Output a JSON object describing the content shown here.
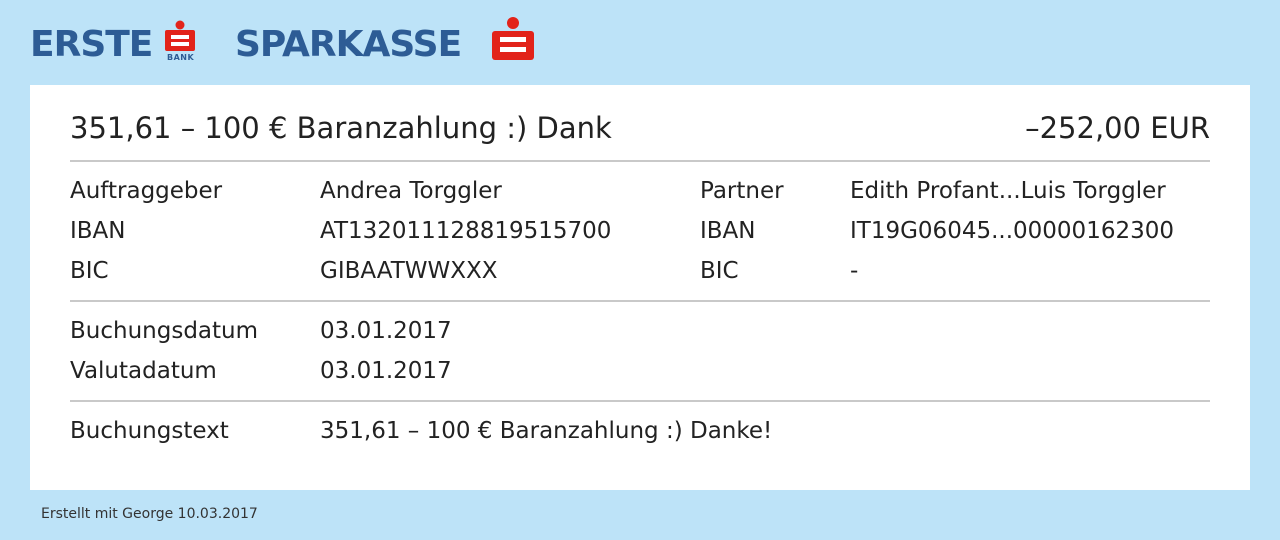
{
  "brand": {
    "logo_left": "ERSTE",
    "logo_left_sub": "BANK",
    "logo_right": "SPARKASSE",
    "color_blue": "#2d5c95",
    "color_red": "#e2231a",
    "icon": "s-mark-icon"
  },
  "header": {
    "title": "351,61 – 100 € Baranzahlung :) Dank",
    "amount": "–252,00 EUR"
  },
  "parties": {
    "auftraggeber_label": "Auftraggeber",
    "auftraggeber_value": "Andrea Torggler",
    "iban_label": "IBAN",
    "iban_value": "AT132011128819515700",
    "bic_label": "BIC",
    "bic_value": "GIBAATWWXXX",
    "partner_label": "Partner",
    "partner_value": "Edith Profant...Luis Torggler",
    "partner_iban_label": "IBAN",
    "partner_iban_value": "IT19G06045...00000162300",
    "partner_bic_label": "BIC",
    "partner_bic_value": "-"
  },
  "dates": {
    "buchungsdatum_label": "Buchungsdatum",
    "buchungsdatum_value": "03.01.2017",
    "valutadatum_label": "Valutadatum",
    "valutadatum_value": "03.01.2017"
  },
  "text": {
    "buchungstext_label": "Buchungstext",
    "buchungstext_value": "351,61 – 100 € Baranzahlung :) Danke!"
  },
  "footer": {
    "created": "Erstellt mit George 10.03.2017"
  }
}
